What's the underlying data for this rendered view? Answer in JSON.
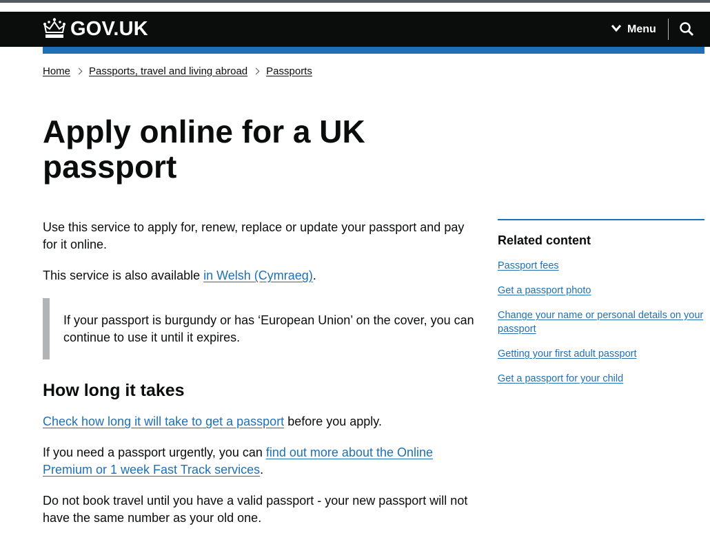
{
  "header": {
    "logo_text": "GOV.UK",
    "menu_label": "Menu",
    "colors": {
      "header_bg": "#0b0c0c",
      "accent_bar": "#1d70b8",
      "link": "#1d70b8"
    }
  },
  "breadcrumb": {
    "items": [
      "Home",
      "Passports, travel and living abroad",
      "Passports"
    ]
  },
  "page": {
    "title": "Apply online for a UK passport"
  },
  "main": {
    "intro": "Use this service to apply for, renew, replace or update your passport and pay for it online.",
    "welsh_prefix": "This service is also available ",
    "welsh_link": "in Welsh (Cymraeg)",
    "welsh_suffix": ".",
    "inset": "If your passport is burgundy or has ‘European Union’ on the cover, you can continue to use it until it expires.",
    "section_heading": "How long it takes",
    "check_link": "Check how long it will take to get a passport",
    "check_suffix": " before you apply.",
    "urgent_prefix": "If you need a passport urgently, you can ",
    "urgent_link": "find out more about the Online Premium or 1 week Fast Track services",
    "urgent_suffix": ".",
    "travel_note": "Do not book travel until you have a valid passport - your new passport will not have the same number as your old one."
  },
  "related": {
    "heading": "Related content",
    "links": [
      "Passport fees",
      "Get a passport photo",
      "Change your name or personal details on your passport",
      "Getting your first adult passport",
      "Get a passport for your child"
    ]
  },
  "icons": [
    "crown-icon",
    "chevron-down-icon",
    "search-icon",
    "chevron-right-icon"
  ]
}
